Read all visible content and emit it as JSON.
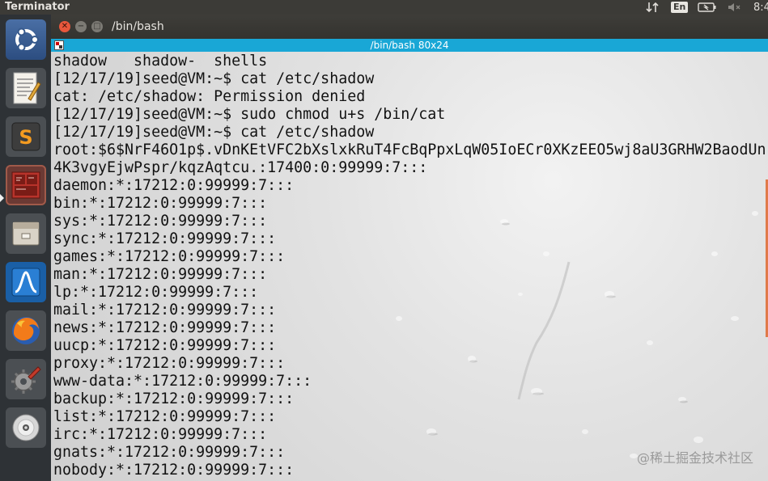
{
  "top_panel": {
    "app_title": "Terminator",
    "language": "En",
    "clock": "8:4"
  },
  "launcher": {
    "items": [
      {
        "name": "ubuntu-dash-icon",
        "color": "#7a2c6b"
      },
      {
        "name": "text-editor-icon",
        "color": "#c9c4b8"
      },
      {
        "name": "sublime-text-icon",
        "color": "#3b3b3b"
      },
      {
        "name": "terminator-icon",
        "color": "#b8332b"
      },
      {
        "name": "file-manager-icon",
        "color": "#8b8378"
      },
      {
        "name": "wireshark-icon",
        "color": "#1d6fb8"
      },
      {
        "name": "firefox-icon",
        "color": "#2a5db0"
      },
      {
        "name": "system-settings-icon",
        "color": "#6d6d6d"
      },
      {
        "name": "dvd-icon",
        "color": "#9a9a9a"
      }
    ]
  },
  "window": {
    "title": "/bin/bash"
  },
  "terminal": {
    "header_title": "/bin/bash 80x24",
    "lines": [
      "shadow   shadow-  shells",
      "[12/17/19]seed@VM:~$ cat /etc/shadow",
      "cat: /etc/shadow: Permission denied",
      "[12/17/19]seed@VM:~$ sudo chmod u+s /bin/cat",
      "[12/17/19]seed@VM:~$ cat /etc/shadow",
      "root:$6$NrF46O1p$.vDnKEtVFC2bXslxkRuT4FcBqPpxLqW05IoECr0XKzEEO5wj8aU3GRHW2BaodUn",
      "4K3vgyEjwPspr/kqzAqtcu.:17400:0:99999:7:::",
      "daemon:*:17212:0:99999:7:::",
      "bin:*:17212:0:99999:7:::",
      "sys:*:17212:0:99999:7:::",
      "sync:*:17212:0:99999:7:::",
      "games:*:17212:0:99999:7:::",
      "man:*:17212:0:99999:7:::",
      "lp:*:17212:0:99999:7:::",
      "mail:*:17212:0:99999:7:::",
      "news:*:17212:0:99999:7:::",
      "uucp:*:17212:0:99999:7:::",
      "proxy:*:17212:0:99999:7:::",
      "www-data:*:17212:0:99999:7:::",
      "backup:*:17212:0:99999:7:::",
      "list:*:17212:0:99999:7:::",
      "irc:*:17212:0:99999:7:::",
      "gnats:*:17212:0:99999:7:::",
      "nobody:*:17212:0:99999:7:::"
    ]
  },
  "watermark": "@稀土掘金技术社区"
}
